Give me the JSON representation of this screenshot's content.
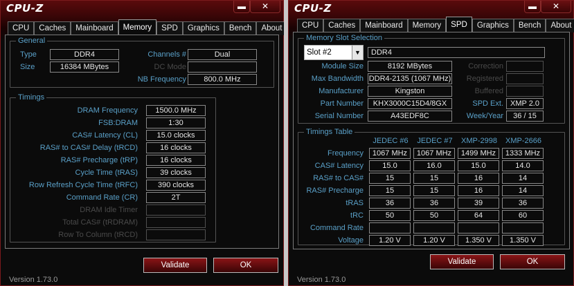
{
  "left": {
    "title": "CPU-Z",
    "tabs": [
      "CPU",
      "Caches",
      "Mainboard",
      "Memory",
      "SPD",
      "Graphics",
      "Bench",
      "About"
    ],
    "active_tab": "Memory",
    "general": {
      "title": "General",
      "type_label": "Type",
      "type_value": "DDR4",
      "size_label": "Size",
      "size_value": "16384 MBytes",
      "channels_label": "Channels #",
      "channels_value": "Dual",
      "dcmode_label": "DC Mode",
      "dcmode_value": "",
      "nbfreq_label": "NB Frequency",
      "nbfreq_value": "800.0 MHz"
    },
    "timings": {
      "title": "Timings",
      "rows": [
        {
          "label": "DRAM Frequency",
          "value": "1500.0 MHz"
        },
        {
          "label": "FSB:DRAM",
          "value": "1:30"
        },
        {
          "label": "CAS# Latency (CL)",
          "value": "15.0 clocks"
        },
        {
          "label": "RAS# to CAS# Delay (tRCD)",
          "value": "16 clocks"
        },
        {
          "label": "RAS# Precharge (tRP)",
          "value": "16 clocks"
        },
        {
          "label": "Cycle Time (tRAS)",
          "value": "39 clocks"
        },
        {
          "label": "Row Refresh Cycle Time (tRFC)",
          "value": "390 clocks"
        },
        {
          "label": "Command Rate (CR)",
          "value": "2T"
        },
        {
          "label": "DRAM Idle Timer",
          "value": ""
        },
        {
          "label": "Total CAS# (tRDRAM)",
          "value": ""
        },
        {
          "label": "Row To Column (tRCD)",
          "value": ""
        }
      ]
    },
    "validate": "Validate",
    "ok": "OK",
    "version": "Version 1.73.0"
  },
  "right": {
    "title": "CPU-Z",
    "tabs": [
      "CPU",
      "Caches",
      "Mainboard",
      "Memory",
      "SPD",
      "Graphics",
      "Bench",
      "About"
    ],
    "active_tab": "SPD",
    "slot": {
      "title": "Memory Slot Selection",
      "selected": "Slot #2",
      "type_value": "DDR4",
      "module_size_label": "Module Size",
      "module_size": "8192 MBytes",
      "max_bw_label": "Max Bandwidth",
      "max_bw": "DDR4-2135 (1067 MHz)",
      "manufacturer_label": "Manufacturer",
      "manufacturer": "Kingston",
      "part_label": "Part Number",
      "part": "KHX3000C15D4/8GX",
      "serial_label": "Serial Number",
      "serial": "A43EDF8C",
      "correction_label": "Correction",
      "correction": "",
      "registered_label": "Registered",
      "registered": "",
      "buffered_label": "Buffered",
      "buffered": "",
      "spdext_label": "SPD Ext.",
      "spdext": "XMP 2.0",
      "weekyear_label": "Week/Year",
      "weekyear": "36 / 15"
    },
    "timings_table": {
      "title": "Timings Table",
      "columns": [
        "JEDEC #6",
        "JEDEC #7",
        "XMP-2998",
        "XMP-2666"
      ],
      "rows": [
        {
          "label": "Frequency",
          "values": [
            "1067 MHz",
            "1067 MHz",
            "1499 MHz",
            "1333 MHz"
          ]
        },
        {
          "label": "CAS# Latency",
          "values": [
            "15.0",
            "16.0",
            "15.0",
            "14.0"
          ]
        },
        {
          "label": "RAS# to CAS#",
          "values": [
            "15",
            "15",
            "16",
            "14"
          ]
        },
        {
          "label": "RAS# Precharge",
          "values": [
            "15",
            "15",
            "16",
            "14"
          ]
        },
        {
          "label": "tRAS",
          "values": [
            "36",
            "36",
            "39",
            "36"
          ]
        },
        {
          "label": "tRC",
          "values": [
            "50",
            "50",
            "64",
            "60"
          ]
        },
        {
          "label": "Command Rate",
          "values": [
            "",
            "",
            "",
            ""
          ]
        },
        {
          "label": "Voltage",
          "values": [
            "1.20 V",
            "1.20 V",
            "1.350 V",
            "1.350 V"
          ]
        }
      ]
    },
    "validate": "Validate",
    "ok": "OK",
    "version": "Version 1.73.0"
  },
  "colors": {
    "label": "#5aa0c8",
    "accent_red": "#8a1416",
    "background": "#0b0b0b"
  }
}
